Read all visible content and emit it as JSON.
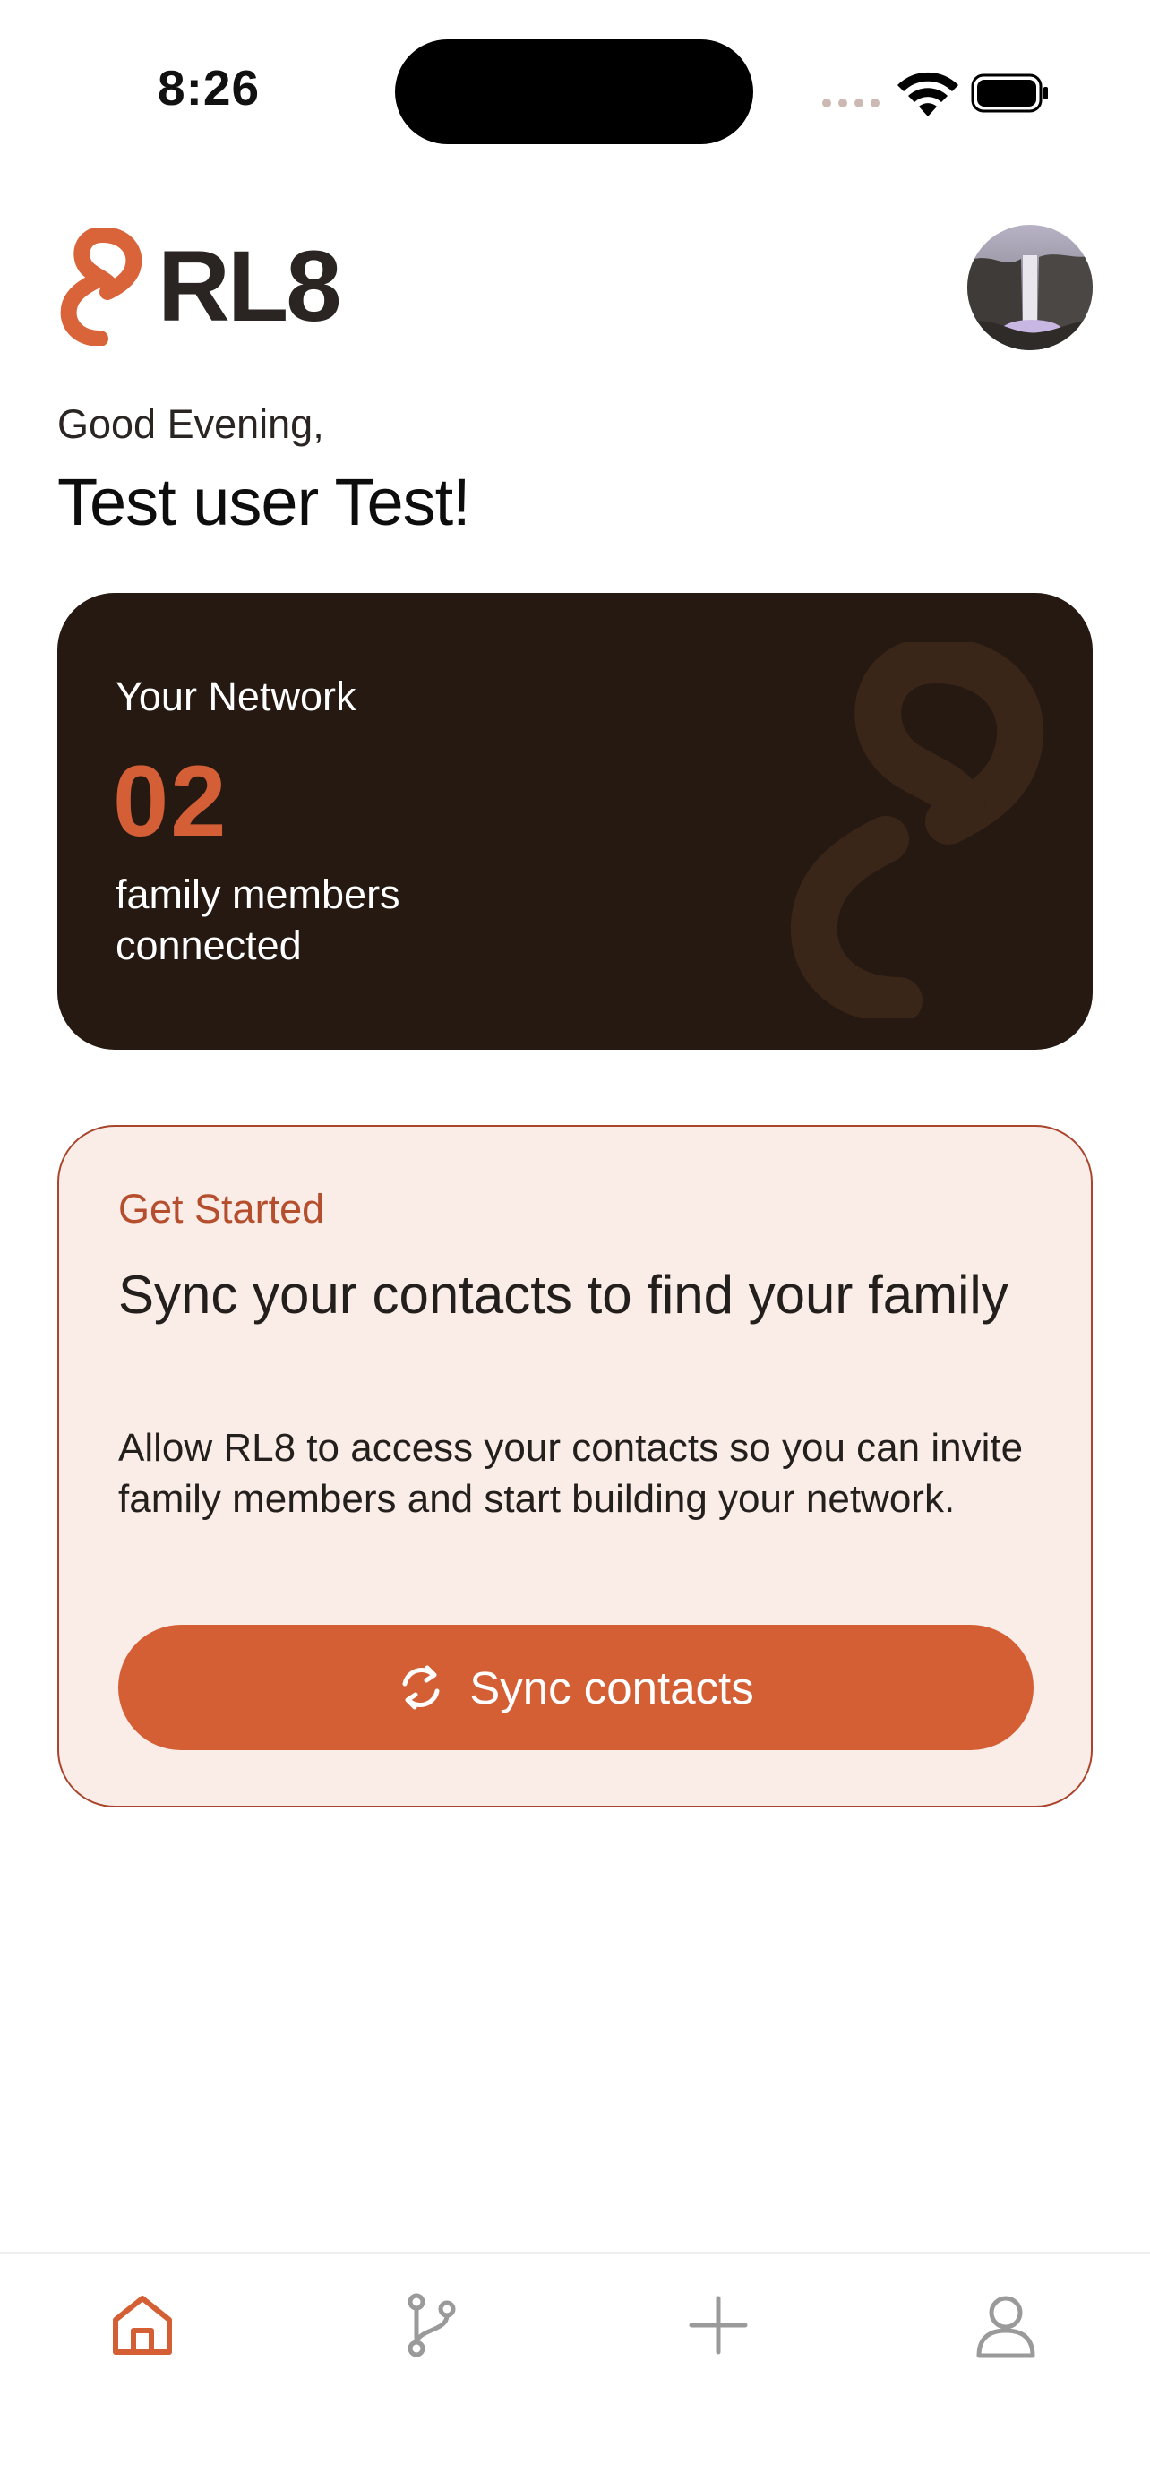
{
  "status_bar": {
    "time": "8:26",
    "icons": [
      "cellular-signal-icon",
      "wifi-icon",
      "battery-icon"
    ]
  },
  "header": {
    "logo_text": "RL8",
    "logo_icon": "chain-link-logo-icon",
    "avatar": "profile-avatar-waterfall"
  },
  "greeting": {
    "salutation": "Good Evening,",
    "name": "Test user Test!"
  },
  "network_card": {
    "title": "Your Network",
    "count": "02",
    "subtitle": "family members connected"
  },
  "get_started_card": {
    "kicker": "Get Started",
    "title": "Sync your contacts to find your family",
    "body": "Allow RL8 to access your contacts so you can invite family members and start building your network.",
    "button_label": "Sync contacts",
    "button_icon": "sync-icon"
  },
  "tab_bar": {
    "tabs": [
      {
        "icon": "home-icon",
        "active": true
      },
      {
        "icon": "branch-icon",
        "active": false
      },
      {
        "icon": "plus-icon",
        "active": false
      },
      {
        "icon": "profile-icon",
        "active": false
      }
    ]
  },
  "colors": {
    "accent": "#d45f35",
    "dark_card": "#251912",
    "light_card": "#faece7",
    "inactive_icon": "#9a9a9a"
  }
}
